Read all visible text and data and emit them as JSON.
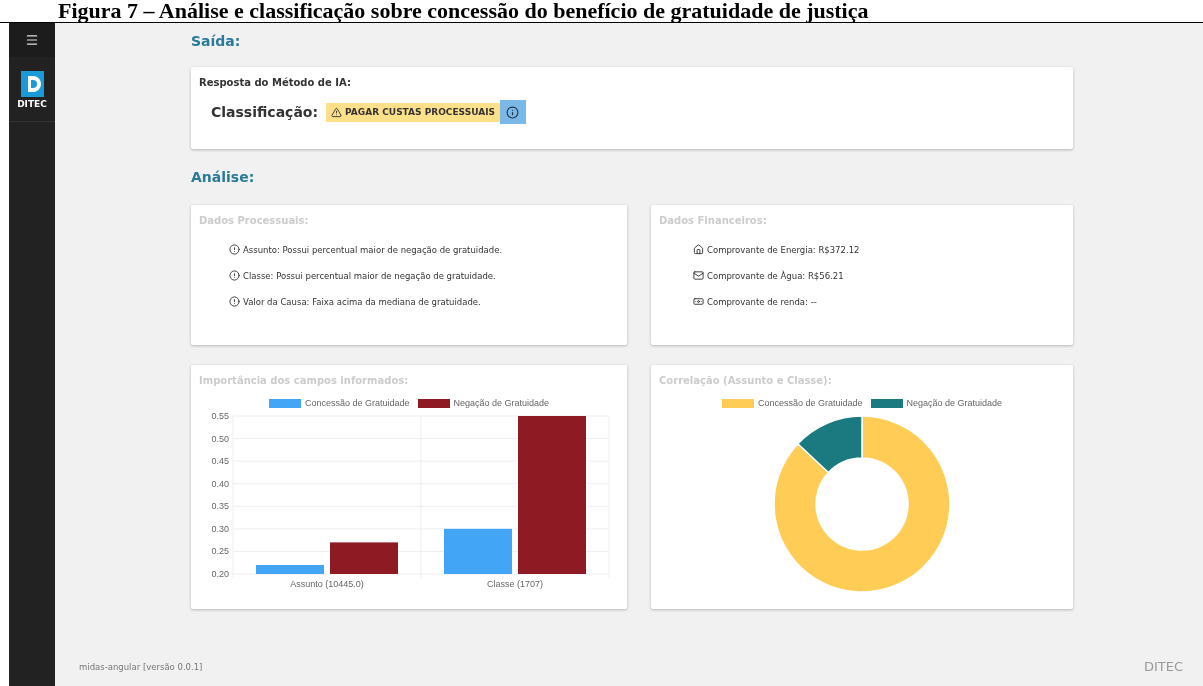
{
  "caption": "Figura 7 – Análise e classificação sobre concessão do benefício de gratuidade de justiça",
  "sidebar": {
    "logo_text": "DITEC"
  },
  "output": {
    "title": "Saída:",
    "card_title": "Resposta do Método de IA:",
    "label": "Classificação:",
    "result": "PAGAR CUSTAS PROCESSUAIS"
  },
  "analysis": {
    "title": "Análise:",
    "process_data": {
      "title": "Dados Processuais:",
      "items": [
        "Assunto: Possui percentual maior de negação de gratuidade.",
        "Classe: Possui percentual maior de negação de gratuidade.",
        "Valor da Causa: Faixa acima da mediana de gratuidade."
      ]
    },
    "financial_data": {
      "title": "Dados Financeiros:",
      "items": [
        {
          "kind": "house",
          "text": "Comprovante de Energia: R$372.12"
        },
        {
          "kind": "mail",
          "text": "Comprovante de Àgua: R$56.21"
        },
        {
          "kind": "money",
          "text": "Comprovante de renda: --"
        }
      ]
    },
    "importance": {
      "title": "Importância dos campos informados:",
      "chart_data": {
        "type": "bar",
        "categories": [
          "Assunto (10445.0)",
          "Classe (1707)"
        ],
        "series": [
          {
            "name": "Concessão de Gratuidade",
            "color": "#42a5f5",
            "values": [
              0.22,
              0.3
            ]
          },
          {
            "name": "Negação de Gratuidade",
            "color": "#8e1a24",
            "values": [
              0.27,
              0.55
            ]
          }
        ],
        "grid": true,
        "legend": "top",
        "ylim": [
          0.2,
          0.55
        ],
        "yticks": [
          {
            "value": 0.2,
            "label": "0.20"
          },
          {
            "value": 0.25,
            "label": "0.25"
          },
          {
            "value": 0.3,
            "label": "0.30"
          },
          {
            "value": 0.35,
            "label": "0.35"
          },
          {
            "value": 0.4,
            "label": "0.40"
          },
          {
            "value": 0.45,
            "label": "0.45"
          },
          {
            "value": 0.5,
            "label": "0.50"
          },
          {
            "value": 0.55,
            "label": "0.55"
          }
        ]
      }
    },
    "correlation": {
      "title": "Correlação (Assunto e Classe):",
      "legend": [
        {
          "label": "Concessão de Gratuidade",
          "color": "#ffcd56"
        },
        {
          "label": "Negação de Gratuidade",
          "color": "#1a7a80"
        }
      ]
    }
  },
  "footer": {
    "version": "midas-angular [versão 0.0.1]",
    "brand": "DITEC"
  }
}
